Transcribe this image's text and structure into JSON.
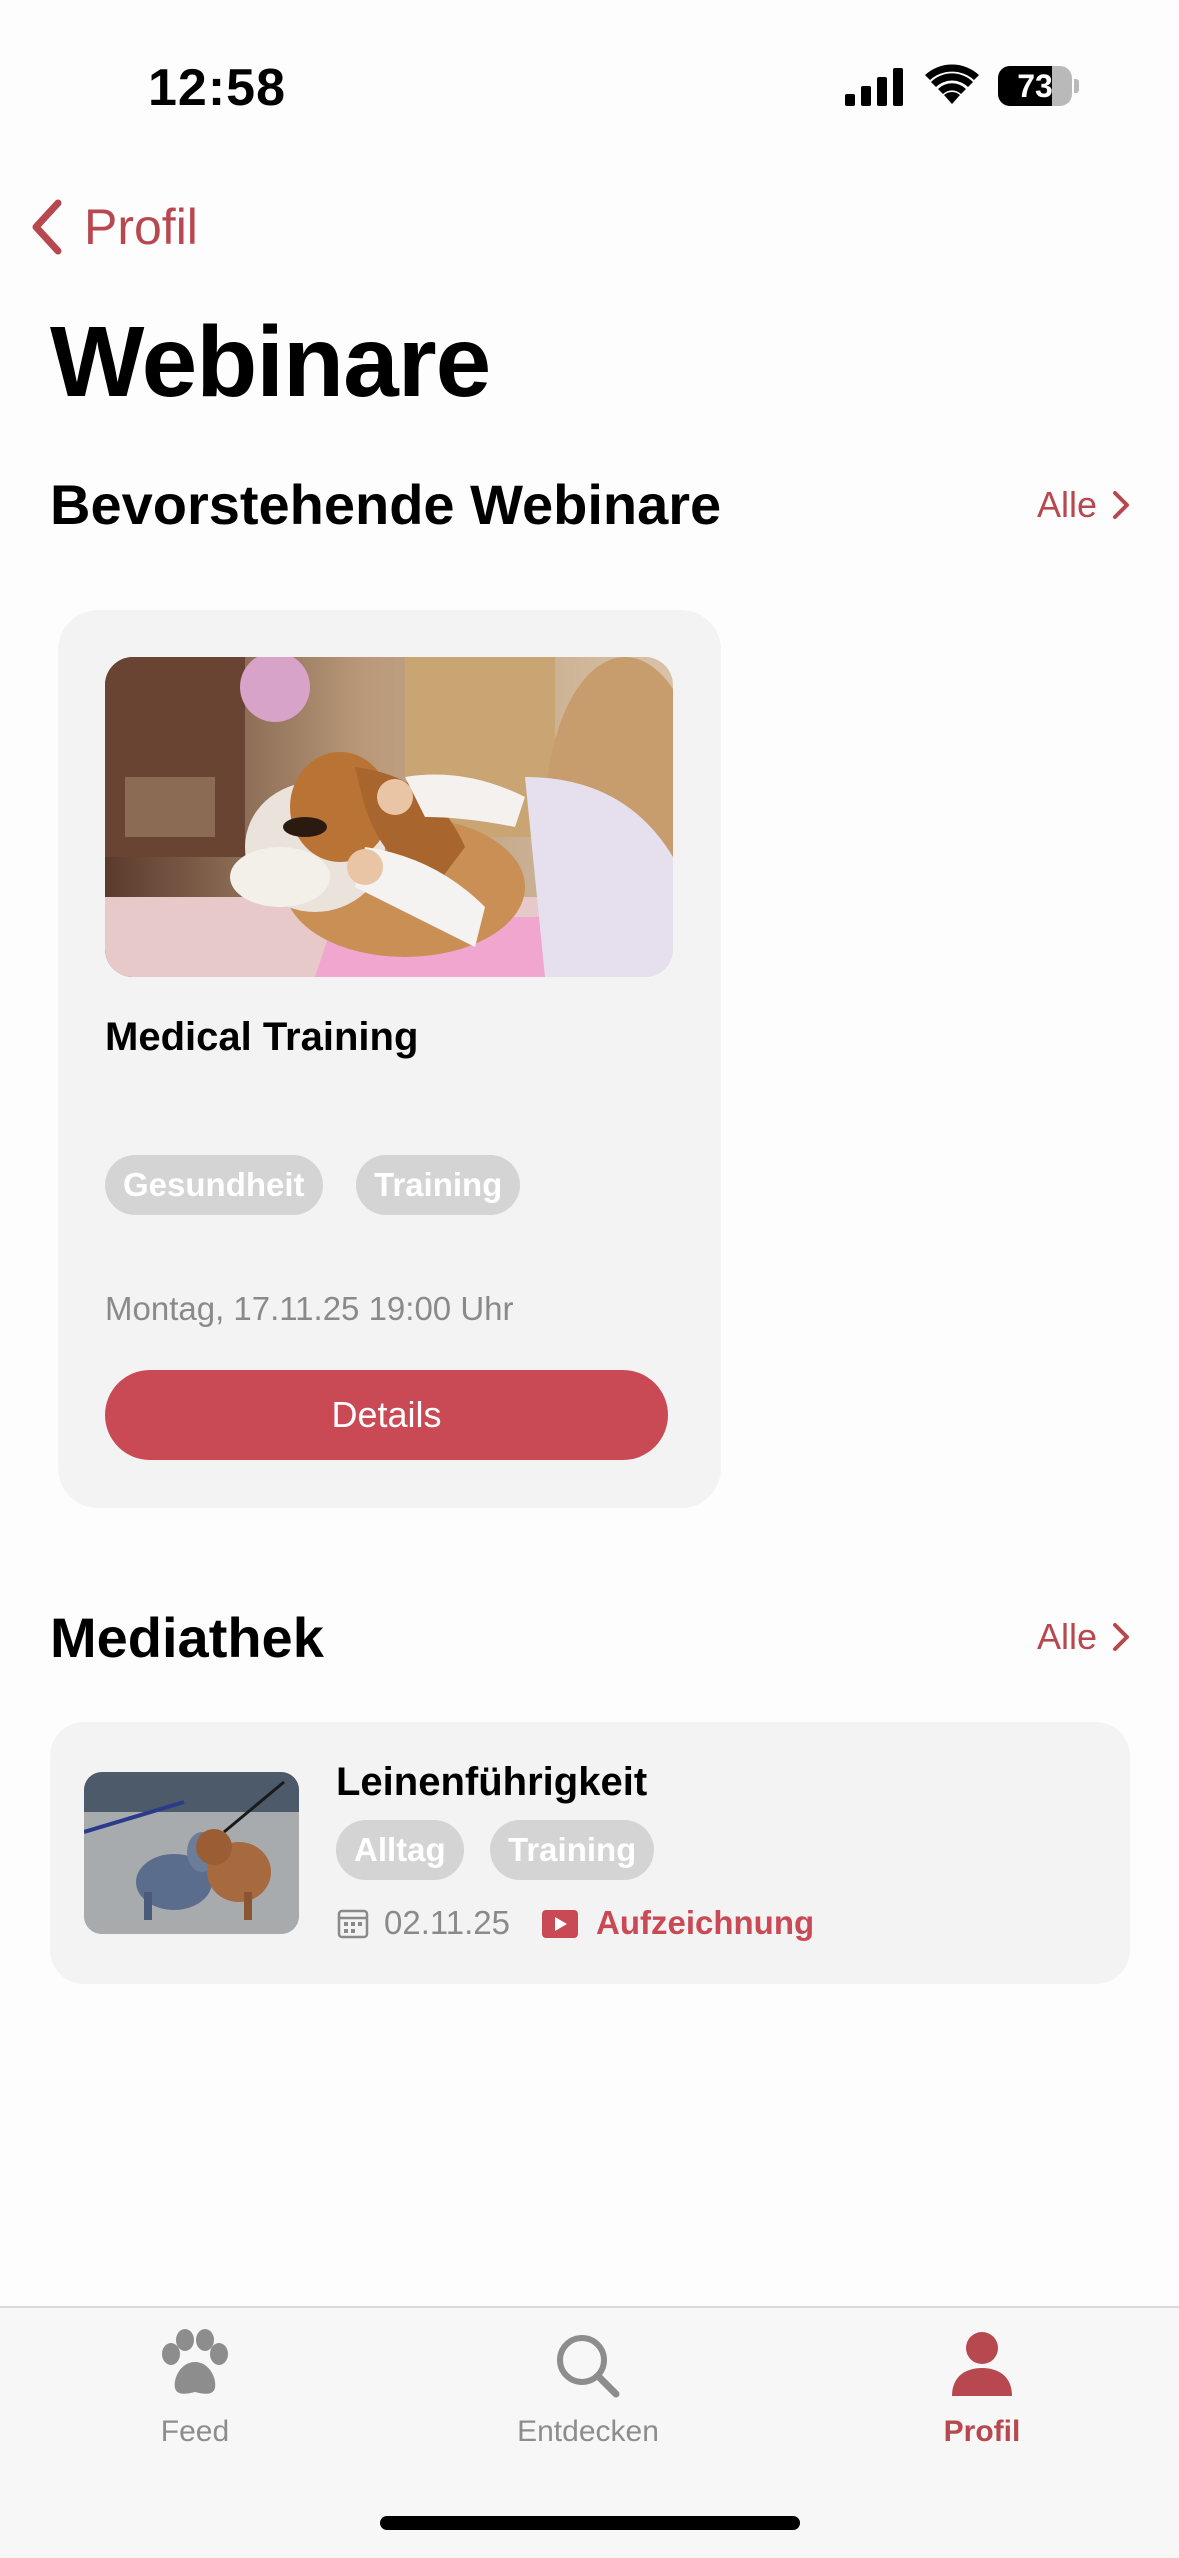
{
  "status_bar": {
    "time": "12:58",
    "battery": "73",
    "battery_level": 0.73
  },
  "nav": {
    "back_label": "Profil"
  },
  "page": {
    "title": "Webinare"
  },
  "upcoming": {
    "title": "Bevorstehende Webinare",
    "all_label": "Alle",
    "card": {
      "title": "Medical Training",
      "tags": [
        "Gesundheit",
        "Training"
      ],
      "date": "Montag, 17.11.25 19:00 Uhr",
      "button": "Details"
    }
  },
  "media": {
    "title": "Mediathek",
    "all_label": "Alle",
    "item": {
      "title": "Leinenführigkeit",
      "tags": [
        "Alltag",
        "Training"
      ],
      "date": "02.11.25",
      "type": "Aufzeichnung"
    }
  },
  "tabbar": {
    "items": [
      {
        "label": "Feed",
        "icon": "paw-icon"
      },
      {
        "label": "Entdecken",
        "icon": "search-icon"
      },
      {
        "label": "Profil",
        "icon": "person-icon",
        "active": true
      }
    ]
  },
  "colors": {
    "accent": "#c94a55",
    "tag_bg": "#d4d4d4",
    "card_bg": "#f3f3f3"
  }
}
